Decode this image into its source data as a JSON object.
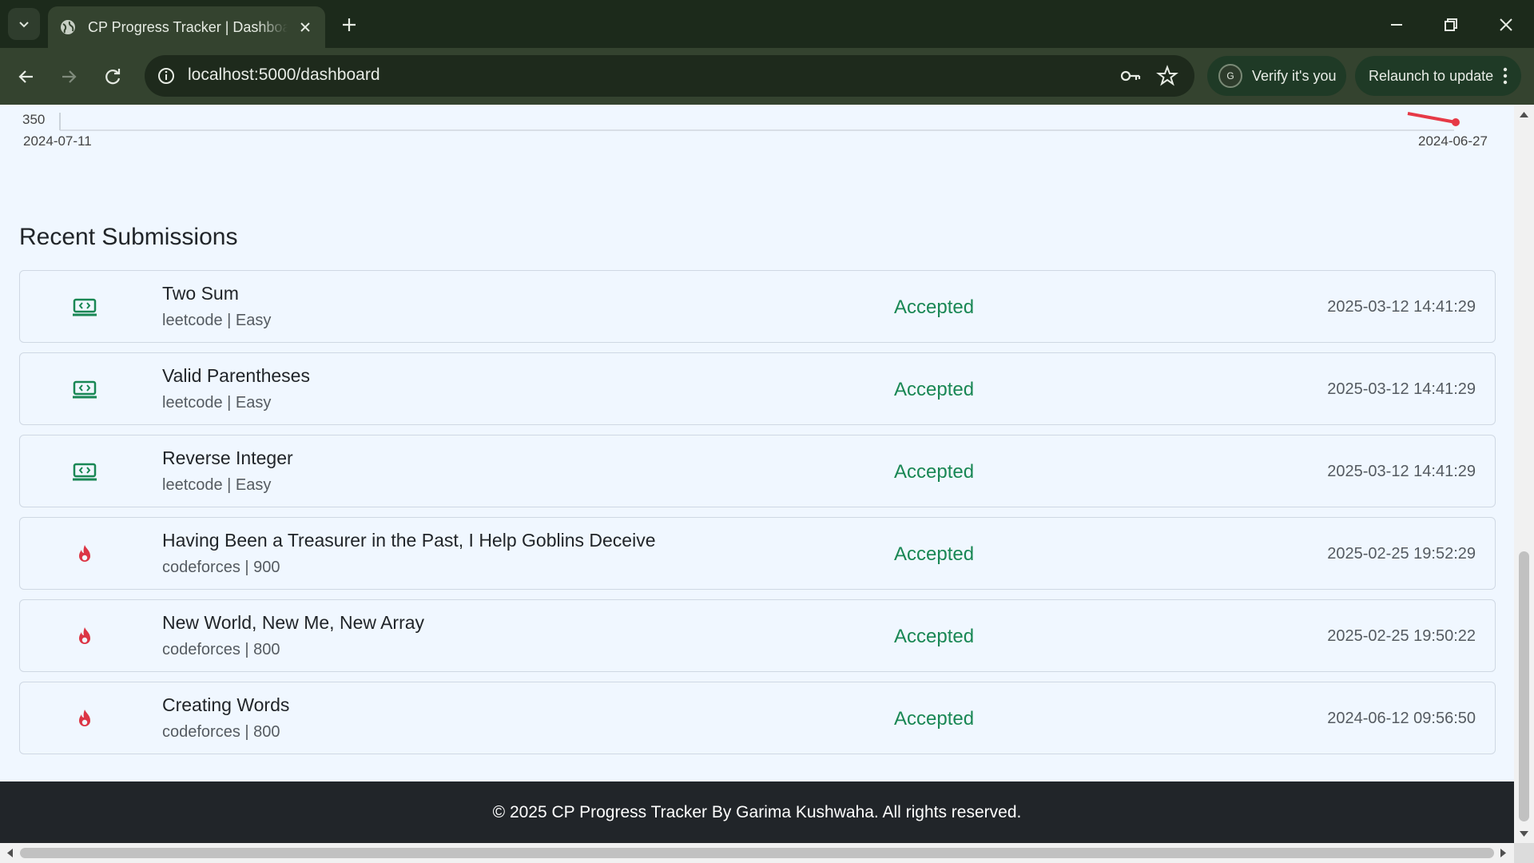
{
  "browser": {
    "tab_title": "CP Progress Tracker | Dashboard",
    "url": "localhost:5000/dashboard",
    "verify_label": "Verify it's you",
    "verify_avatar": "G",
    "relaunch_label": "Relaunch to update",
    "colors": {
      "frame": "#1c2a1b",
      "toolbar": "#34432f"
    }
  },
  "chart": {
    "y_tick": "350",
    "x_start": "2024-07-11",
    "x_end": "2024-06-27",
    "line_color": "#e63946"
  },
  "submissions": {
    "title": "Recent Submissions",
    "items": [
      {
        "name": "Two Sum",
        "meta": "leetcode | Easy",
        "status": "Accepted",
        "time": "2025-03-12 14:41:29",
        "icon": "leetcode-icon"
      },
      {
        "name": "Valid Parentheses",
        "meta": "leetcode | Easy",
        "status": "Accepted",
        "time": "2025-03-12 14:41:29",
        "icon": "leetcode-icon"
      },
      {
        "name": "Reverse Integer",
        "meta": "leetcode | Easy",
        "status": "Accepted",
        "time": "2025-03-12 14:41:29",
        "icon": "leetcode-icon"
      },
      {
        "name": "Having Been a Treasurer in the Past, I Help Goblins Deceive",
        "meta": "codeforces | 900",
        "status": "Accepted",
        "time": "2025-02-25 19:52:29",
        "icon": "codeforces-fire-icon"
      },
      {
        "name": "New World, New Me, New Array",
        "meta": "codeforces | 800",
        "status": "Accepted",
        "time": "2025-02-25 19:50:22",
        "icon": "codeforces-fire-icon"
      },
      {
        "name": "Creating Words",
        "meta": "codeforces | 800",
        "status": "Accepted",
        "time": "2024-06-12 09:56:50",
        "icon": "codeforces-fire-icon"
      }
    ],
    "colors": {
      "accepted": "#198754",
      "leetcode_icon": "#198754",
      "codeforces_icon": "#dc3545"
    }
  },
  "footer": {
    "text": "© 2025 CP Progress Tracker By Garima Kushwaha. All rights reserved."
  }
}
